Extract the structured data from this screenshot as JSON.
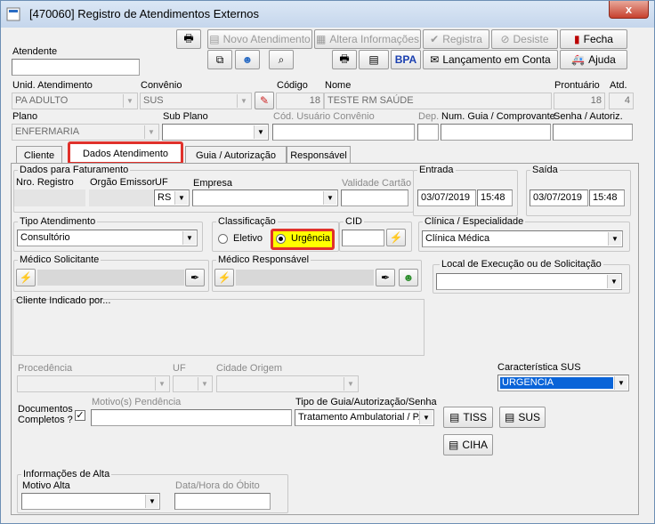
{
  "window": {
    "title": "[470060]  Registro de Atendimentos Externos",
    "close": "x"
  },
  "toolbar": {
    "novo": "Novo Atendimento",
    "altera": "Altera Informações",
    "registra": "Registra",
    "desiste": "Desiste",
    "fecha": "Fecha",
    "bpa": "BPA",
    "lancamento": "Lançamento em Conta",
    "ajuda": "Ajuda"
  },
  "form": {
    "atendente_label": "Atendente",
    "atendente_value": "",
    "unid_label": "Unid. Atendimento",
    "unid_value": "PA ADULTO",
    "convenio_label": "Convênio",
    "convenio_value": "SUS",
    "codigo_label": "Código",
    "codigo_value": "18",
    "nome_label": "Nome",
    "nome_value": "TESTE RM SAÚDE",
    "prontuario_label": "Prontuário",
    "prontuario_value": "18",
    "atd_label": "Atd.",
    "atd_value": "4",
    "plano_label": "Plano",
    "plano_value": "ENFERMARIA",
    "subplano_label": "Sub Plano",
    "subplano_value": "",
    "cod_usuario_label": "Cód. Usuário Convênio",
    "dep_label": "Dep.",
    "num_guia_label": "Num. Guia / Comprovante",
    "senha_label": "Senha / Autoriz."
  },
  "tabs": [
    "Cliente",
    "Dados Atendimento",
    "Guia / Autorização",
    "Responsável"
  ],
  "faturamento": {
    "title": "Dados para Faturamento",
    "nro_registro": "Nro. Registro",
    "orgao": "Orgão Emissor",
    "uf": "UF",
    "uf_value": "RS",
    "empresa": "Empresa",
    "validade": "Validade Cartão"
  },
  "entrada": {
    "title": "Entrada",
    "date": "03/07/2019",
    "time": "15:48"
  },
  "saida": {
    "title": "Saída",
    "date": "03/07/2019",
    "time": "15:48"
  },
  "tipo_atendimento": {
    "title": "Tipo Atendimento",
    "value": "Consultório"
  },
  "classificacao": {
    "title": "Classificação",
    "eletivo": "Eletivo",
    "urgencia": "Urgência"
  },
  "cid": {
    "title": "CID"
  },
  "clinica": {
    "title": "Clínica / Especialidade",
    "value": "Clínica Médica"
  },
  "medico_solicitante": {
    "title": "Médico Solicitante"
  },
  "medico_responsavel": {
    "title": "Médico Responsável"
  },
  "local_execucao": {
    "title": "Local de Execução ou de Solicitação"
  },
  "cliente_indicado": {
    "title": "Cliente Indicado por..."
  },
  "procedencia": {
    "label": "Procedência",
    "uf": "UF",
    "cidade": "Cidade Origem"
  },
  "caracteristica": {
    "label": "Característica SUS",
    "value": "URGENCIA"
  },
  "documentos": {
    "label1": "Documentos",
    "label2": "Completos ?",
    "check": "✓",
    "motivo": "Motivo(s) Pendência"
  },
  "tipo_guia": {
    "label": "Tipo de Guia/Autorização/Senha",
    "value": "Tratamento Ambulatorial / P."
  },
  "guia_buttons": {
    "tiss": "TISS",
    "sus": "SUS",
    "ciha": "CIHA"
  },
  "alta": {
    "title": "Informações de Alta",
    "motivo": "Motivo Alta",
    "data_hora": "Data/Hora do Óbito"
  },
  "icons": [
    "printer-icon",
    "documents-icon",
    "magnifier-icon",
    "person-icon",
    "ambulance-icon",
    "door-icon",
    "lightning-icon",
    "pen-icon"
  ],
  "colors": {
    "highlight": "#e0312b",
    "selection": "#0a64d8",
    "urgencia_bg": "#ffff00"
  }
}
